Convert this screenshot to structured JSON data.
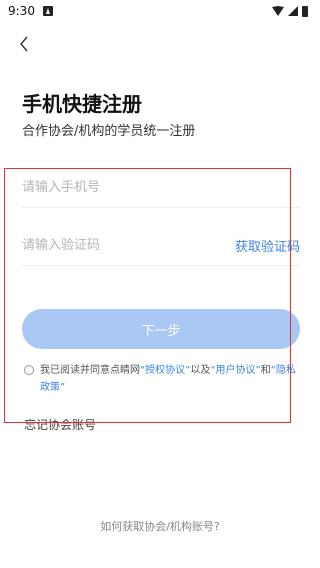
{
  "status_bar": {
    "time": "9:30"
  },
  "header": {
    "title": "手机快捷注册",
    "subtitle": "合作协会/机构的学员统一注册"
  },
  "form": {
    "phone_placeholder": "请输入手机号",
    "code_placeholder": "请输入验证码",
    "get_code_label": "获取验证码",
    "next_label": "下一步"
  },
  "agreement": {
    "prefix": "我已阅读并同意点睛网",
    "auth_link": "“授权协议”",
    "sep1": "以及",
    "user_link": "“用户协议”",
    "sep2": "和",
    "privacy_link": "“隐私政策”"
  },
  "footer": {
    "forgot_label": "忘记协会账号",
    "how_to_label": "如何获取协会/机构账号?"
  },
  "colors": {
    "accent": "#3d86e6",
    "button_disabled": "#a9c8f3",
    "highlight_border": "#e03030"
  }
}
